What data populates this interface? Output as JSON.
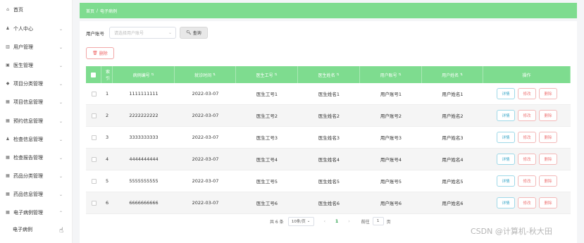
{
  "sidebar": {
    "items": [
      {
        "label": "首页",
        "icon": "home-icon",
        "glyph": "⌂",
        "has_chevron": false
      },
      {
        "label": "个人中心",
        "icon": "user-icon",
        "glyph": "♟",
        "has_chevron": true
      },
      {
        "label": "用户管理",
        "icon": "users-icon",
        "glyph": "▥",
        "has_chevron": true
      },
      {
        "label": "医生管理",
        "icon": "doctor-icon",
        "glyph": "▣",
        "has_chevron": true
      },
      {
        "label": "项目分类管理",
        "icon": "tag-icon",
        "glyph": "◆",
        "has_chevron": true
      },
      {
        "label": "项目信息管理",
        "icon": "grid-icon",
        "glyph": "▦",
        "has_chevron": true
      },
      {
        "label": "预约信息管理",
        "icon": "grid-icon",
        "glyph": "▦",
        "has_chevron": true
      },
      {
        "label": "检查信息管理",
        "icon": "person-icon",
        "glyph": "♟",
        "has_chevron": true
      },
      {
        "label": "检查报告管理",
        "icon": "grid-icon",
        "glyph": "▦",
        "has_chevron": true
      },
      {
        "label": "药品分类管理",
        "icon": "grid-icon",
        "glyph": "▦",
        "has_chevron": true
      },
      {
        "label": "药品信息管理",
        "icon": "grid-icon",
        "glyph": "▦",
        "has_chevron": true
      },
      {
        "label": "电子病例管理",
        "icon": "grid-icon",
        "glyph": "▦",
        "has_chevron": true,
        "expanded": true
      }
    ],
    "sub_item": "电子病例"
  },
  "breadcrumb": {
    "home": "首页",
    "separator": "/",
    "current": "电子病例"
  },
  "search": {
    "label": "用户账号",
    "placeholder": "请选择用户账号",
    "button": "查询"
  },
  "delete_button": "删除",
  "table": {
    "headers": {
      "index": "索引",
      "no": "病例编号",
      "date": "就诊时间",
      "doctor_id": "医生工号",
      "doctor_name": "医生姓名",
      "user_id": "用户账号",
      "user_name": "用户姓名",
      "actions": "操作"
    },
    "rows": [
      {
        "index": "1",
        "no": "1111111111",
        "date": "2022-03-07",
        "doctor_id": "医生工号1",
        "doctor_name": "医生姓名1",
        "user_id": "用户账号1",
        "user_name": "用户姓名1"
      },
      {
        "index": "2",
        "no": "2222222222",
        "date": "2022-03-07",
        "doctor_id": "医生工号2",
        "doctor_name": "医生姓名2",
        "user_id": "用户账号2",
        "user_name": "用户姓名2"
      },
      {
        "index": "3",
        "no": "3333333333",
        "date": "2022-03-07",
        "doctor_id": "医生工号3",
        "doctor_name": "医生姓名3",
        "user_id": "用户账号3",
        "user_name": "用户姓名3"
      },
      {
        "index": "4",
        "no": "4444444444",
        "date": "2022-03-07",
        "doctor_id": "医生工号4",
        "doctor_name": "医生姓名4",
        "user_id": "用户账号4",
        "user_name": "用户姓名4"
      },
      {
        "index": "5",
        "no": "5555555555",
        "date": "2022-03-07",
        "doctor_id": "医生工号5",
        "doctor_name": "医生姓名5",
        "user_id": "用户账号5",
        "user_name": "用户姓名5"
      },
      {
        "index": "6",
        "no": "6666666666",
        "date": "2022-03-07",
        "doctor_id": "医生工号6",
        "doctor_name": "医生姓名6",
        "user_id": "用户账号6",
        "user_name": "用户姓名6"
      }
    ],
    "action_labels": {
      "detail": "详情",
      "edit": "修改",
      "delete": "删除"
    }
  },
  "pagination": {
    "total": "共 6 条",
    "page_size": "10条/页",
    "current_page": "1",
    "goto_label": "前往",
    "goto_value": "1",
    "page_unit": "页"
  },
  "watermark": "CSDN @计算机-秋大田",
  "colors": {
    "accent": "#7edc8f",
    "detail": "#3fa9c9",
    "danger": "#e77777"
  }
}
